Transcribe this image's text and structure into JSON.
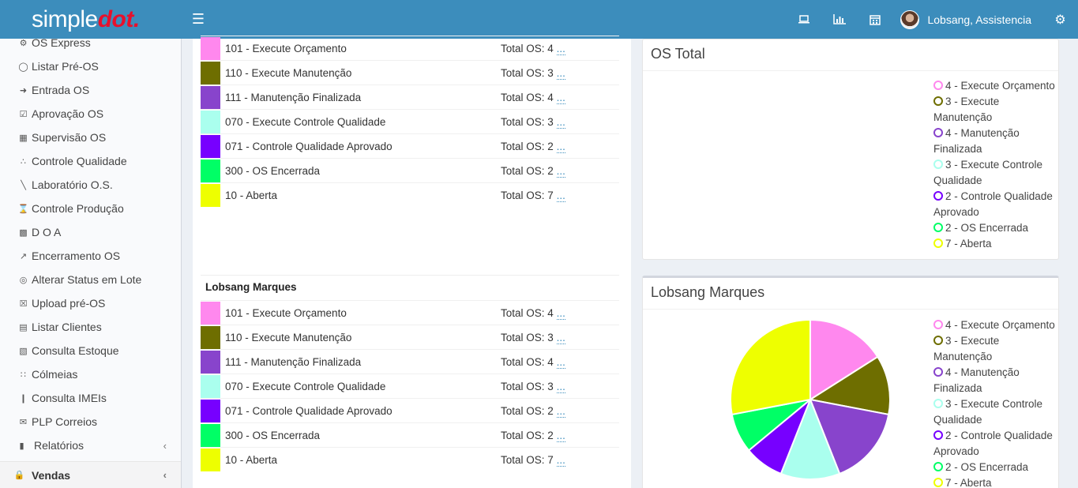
{
  "header": {
    "logo_part1": "simple",
    "logo_part2": "dot.",
    "menu_icon": "hamburger-icon",
    "icons": [
      "laptop-icon",
      "bar-chart-icon",
      "calendar-icon"
    ],
    "user_name": "Lobsang, Assistencia",
    "settings_icon": "gears-icon"
  },
  "sidebar": {
    "items": [
      {
        "label": "OS Express",
        "icon": "gears-icon"
      },
      {
        "label": "Listar Pré-OS",
        "icon": "comment-icon"
      },
      {
        "label": "Entrada OS",
        "icon": "sign-in-icon"
      },
      {
        "label": "Aprovação OS",
        "icon": "check-square-icon"
      },
      {
        "label": "Supervisão OS",
        "icon": "calendar-check-icon"
      },
      {
        "label": "Controle Qualidade",
        "icon": "stethoscope-icon"
      },
      {
        "label": "Laboratório O.S.",
        "icon": "screwdriver-icon"
      },
      {
        "label": "Controle Produção",
        "icon": "hourglass-icon"
      },
      {
        "label": "D O A",
        "icon": "industry-icon"
      },
      {
        "label": "Encerramento OS",
        "icon": "share-icon"
      },
      {
        "label": "Alterar Status em Lote",
        "icon": "bullseye-icon"
      },
      {
        "label": "Upload pré-OS",
        "icon": "file-excel-icon"
      },
      {
        "label": "Listar Clientes",
        "icon": "address-card-icon"
      },
      {
        "label": "Consulta Estoque",
        "icon": "archive-icon"
      },
      {
        "label": "Cólmeias",
        "icon": "grid-icon"
      },
      {
        "label": "Consulta IMEIs",
        "icon": "barcode-icon"
      },
      {
        "label": "PLP Correios",
        "icon": "envelope-icon"
      },
      {
        "label": "Relatórios",
        "icon": "file-icon"
      }
    ],
    "section_label": "Vendas",
    "section_icon": "shopping-bag-icon"
  },
  "status_rows": [
    {
      "name": "101 - Execute Orçamento",
      "total_label": "Total OS: 4",
      "color": "#ff88ee"
    },
    {
      "name": "110 - Execute Manutenção",
      "total_label": "Total OS: 3",
      "color": "#6e6e00"
    },
    {
      "name": "111 - Manutenção Finalizada",
      "total_label": "Total OS: 4",
      "color": "#8844cc"
    },
    {
      "name": "070 - Execute Controle Qualidade",
      "total_label": "Total OS: 3",
      "color": "#aaffee"
    },
    {
      "name": "071 - Controle Qualidade Aprovado",
      "total_label": "Total OS: 2",
      "color": "#7700ff"
    },
    {
      "name": "300 - OS Encerrada",
      "total_label": "Total OS: 2",
      "color": "#00ff66"
    },
    {
      "name": "10 - Aberta",
      "total_label": "Total OS: 7",
      "color": "#eeff00"
    }
  ],
  "more_link": "...",
  "group2_title": "Lobsang Marques",
  "chart1_title": "OS Total",
  "chart2_title": "Lobsang Marques",
  "pie_legend": [
    {
      "label": "4 - Execute Orçamento",
      "color": "#ff88ee"
    },
    {
      "label": "3 - Execute Manutenção",
      "color": "#6e6e00"
    },
    {
      "label": "4 - Manutenção Finalizada",
      "color": "#8844cc"
    },
    {
      "label": "3 - Execute Controle Qualidade",
      "color": "#aaffee"
    },
    {
      "label": "2 - Controle Qualidade Aprovado",
      "color": "#7700ff"
    },
    {
      "label": "2 - OS Encerrada",
      "color": "#00ff66"
    },
    {
      "label": "7 - Aberta",
      "color": "#eeff00"
    }
  ],
  "chart_data": {
    "type": "pie",
    "title": "Lobsang Marques",
    "categories": [
      "Execute Orçamento",
      "Execute Manutenção",
      "Manutenção Finalizada",
      "Execute Controle Qualidade",
      "Controle Qualidade Aprovado",
      "OS Encerrada",
      "Aberta"
    ],
    "values": [
      4,
      3,
      4,
      3,
      2,
      2,
      7
    ],
    "colors": [
      "#ff88ee",
      "#6e6e00",
      "#8844cc",
      "#aaffee",
      "#7700ff",
      "#00ff66",
      "#eeff00"
    ],
    "legend": "right"
  }
}
